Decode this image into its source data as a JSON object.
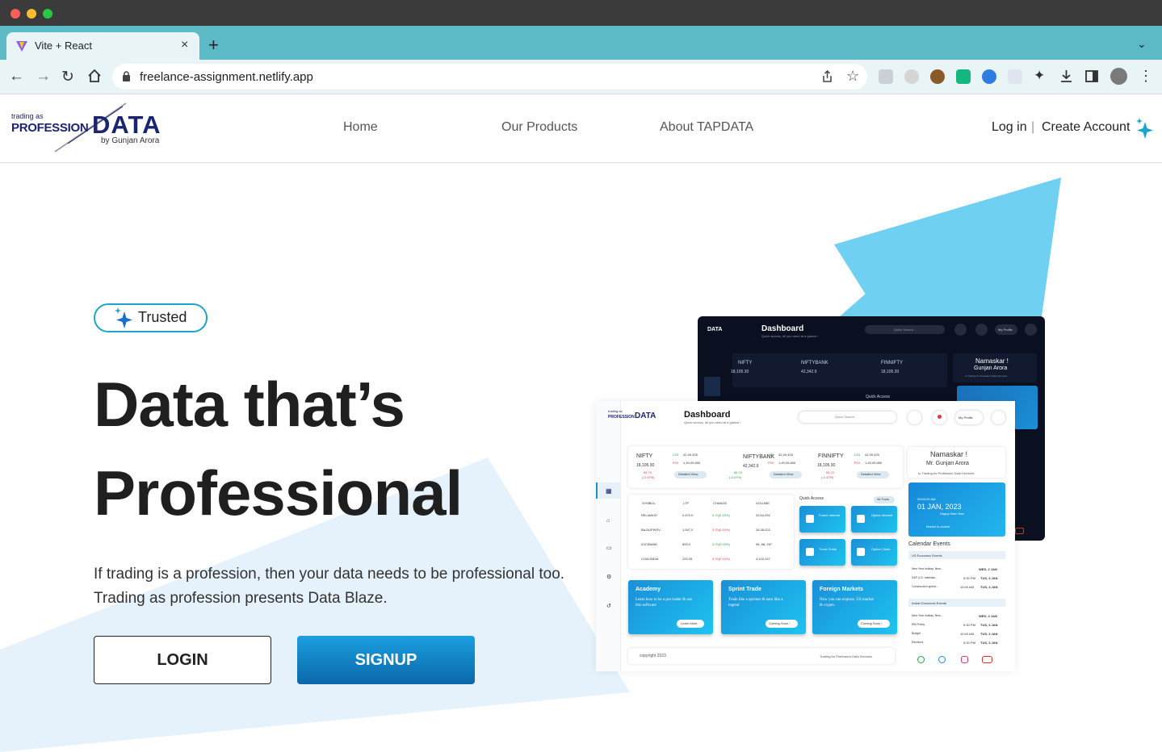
{
  "browser": {
    "tab_title": "Vite + React",
    "url": "freelance-assignment.netlify.app"
  },
  "header": {
    "logo": {
      "small": "trading as",
      "profession": "PROFESSION",
      "data": "DATA",
      "by": "by Gunjan Arora"
    },
    "nav": [
      "Home",
      "Our Products",
      "About TAPDATA"
    ],
    "login": "Log in",
    "separator": "|",
    "create_account": "Create Account"
  },
  "hero": {
    "badge": "Trusted",
    "title_line1": "Data that’s",
    "title_line2": "Professional",
    "subtitle": "If trading is a profession, then your data needs to be professional too. Trading as profession presents Data Blaze.",
    "login_button": "LOGIN",
    "signup_button": "SIGNUP"
  },
  "dashboard_preview": {
    "title": "Dashboard",
    "subtitle": "Quick access, all you need at a glance !",
    "search_placeholder": "Quick Search...",
    "profile": "My Profile",
    "indices": [
      {
        "name": "NIFTY",
        "value": "18,105.30",
        "coi": "42,49,325",
        "poi": "1,49,09,650",
        "change": "65.70",
        "pct": "(-0.47%)"
      },
      {
        "name": "NIFTYBANK",
        "value": "42,342.9",
        "coi": "42,49,325",
        "poi": "1,49,09,650",
        "change": "65.70",
        "pct": "(-0.47%)"
      },
      {
        "name": "FINNIFTY",
        "value": "18,105.30",
        "coi": "42,49,325",
        "poi": "1,49,09,650",
        "change": "65.70",
        "pct": "(-0.47%)"
      }
    ],
    "coi_label": "COI",
    "poi_label": "POI",
    "detailed_view": "Detailed View",
    "greeting": "Namaskar !",
    "greeting_name": "Mr. Gunjan Arora",
    "greeting_sub": "to Trading As Profession Data Services",
    "dark_greeting_name": "Gunjan Arora",
    "date_time": "03:00:00 AM",
    "date": "01 JAN, 2023",
    "holiday": "Happy New Year",
    "market_status": "Market is closed",
    "table_headers": [
      "SYMBOL",
      "LTP",
      "CHANGE",
      "VOLUME"
    ],
    "table_rows": [
      {
        "symbol": "RELIANCE",
        "ltp": "2,670.0",
        "change": "3.70(0.15%)",
        "up": true,
        "volume": "33,64,092"
      },
      {
        "symbol": "BAJAJFINSV",
        "ltp": "1,547.0",
        "change": "3.70(0.15%)",
        "up": false,
        "volume": "26,38,022"
      },
      {
        "symbol": "ICICIBANK",
        "ltp": "893.0",
        "change": "3.70(0.15%)",
        "up": true,
        "volume": "96, 88, 257"
      },
      {
        "symbol": "COALINDIA",
        "ltp": "225.05",
        "change": "3.70(0.15%)",
        "up": false,
        "volume": "4,102,247"
      }
    ],
    "quick_access": "Quick Access",
    "all_tools": "All Tools",
    "tools": [
      "Future Interest",
      "Option Interest",
      "Trend Guide",
      "Option Chain"
    ],
    "promos": [
      {
        "title": "Academy",
        "text": "Learn how to be a pro trader & use this software",
        "button": "Learn More"
      },
      {
        "title": "Sprint Trade",
        "text": "Trade like a sprinter & earn like a legend",
        "button": "Coming Soon !"
      },
      {
        "title": "Foreign Markets",
        "text": "Now you can explore, US market & crypto.",
        "button": "Coming Soon !"
      }
    ],
    "calendar_title": "Calendar Events",
    "us_events_title": "US Economic Events",
    "us_events": [
      {
        "name": "New Year holiday, New...",
        "time": "",
        "date": "WED, 2 JAN"
      },
      {
        "name": "S&P U.S. manufac...",
        "time": "9:30 PM",
        "date": "TUS, 3 JAN"
      },
      {
        "name": "Construction spend...",
        "time": "10:00 AM",
        "date": "TUS, 3 JAN"
      }
    ],
    "in_events_title": "Indian Economic Events",
    "in_events": [
      {
        "name": "New Year holiday, New...",
        "time": "",
        "date": "WED, 2 JAN"
      },
      {
        "name": "RBI Policy",
        "time": "9:30 PM",
        "date": "TUS, 3 JAN"
      },
      {
        "name": "Budget",
        "time": "10:00 AM",
        "date": "TUS, 3 JAN"
      },
      {
        "name": "Elections",
        "time": "9:30 PM",
        "date": "TUS, 3 JAN"
      }
    ],
    "footer_left": "copyright 2023",
    "footer_right": "Trading As Profession Data Services"
  },
  "colors": {
    "accent": "#1ba6c9",
    "brand": "#1b2470",
    "signup_top": "#1c9fe0",
    "signup_bottom": "#0a67a8",
    "tab_strip": "#5cbac7",
    "background_arrow": "#e6f2fb",
    "hero_arrow": "#6fd0f2"
  }
}
